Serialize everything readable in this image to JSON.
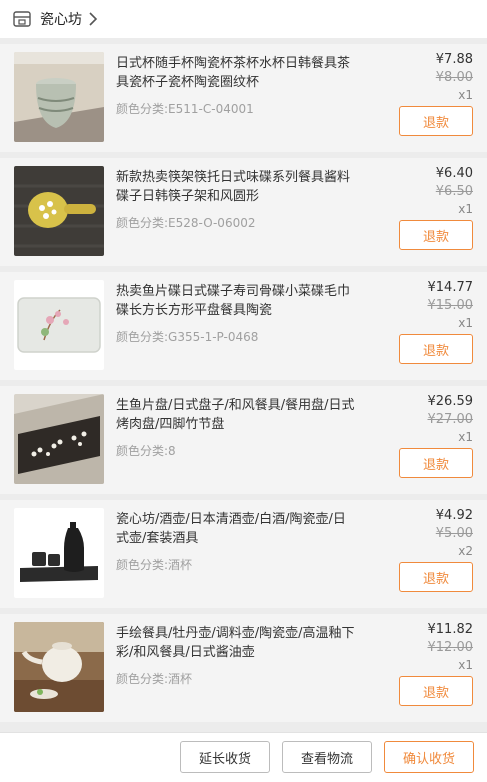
{
  "shop": {
    "name": "瓷心坊",
    "icon": "store-icon",
    "chevron": "chevron-right-icon"
  },
  "items": [
    {
      "title": "日式杯随手杯陶瓷杯茶杯水杯日韩餐具茶具瓷杯子瓷杯陶瓷圈纹杯",
      "sku": "颜色分类:E511-C-04001",
      "price": "¥7.88",
      "original_price": "¥8.00",
      "qty": "x1",
      "refund_label": "退款"
    },
    {
      "title": "新款热卖筷架筷托日式味碟系列餐具酱料碟子日韩筷子架和风圆形",
      "sku": "颜色分类:E528-O-06002",
      "price": "¥6.40",
      "original_price": "¥6.50",
      "qty": "x1",
      "refund_label": "退款"
    },
    {
      "title": "热卖鱼片碟日式碟子寿司骨碟小菜碟毛巾碟长方长方形平盘餐具陶瓷",
      "sku": "颜色分类:G355-1-P-0468",
      "price": "¥14.77",
      "original_price": "¥15.00",
      "qty": "x1",
      "refund_label": "退款"
    },
    {
      "title": "生鱼片盘/日式盘子/和风餐具/餐用盘/日式烤肉盘/四脚竹节盘",
      "sku": "颜色分类:8",
      "price": "¥26.59",
      "original_price": "¥27.00",
      "qty": "x1",
      "refund_label": "退款"
    },
    {
      "title": "瓷心坊/酒壶/日本清酒壶/白酒/陶瓷壶/日式壶/套装酒具",
      "sku": "颜色分类:酒杯",
      "price": "¥4.92",
      "original_price": "¥5.00",
      "qty": "x2",
      "refund_label": "退款"
    },
    {
      "title": "手绘餐具/牡丹壶/调料壶/陶瓷壶/高温釉下彩/和风餐具/日式酱油壶",
      "sku": "颜色分类:酒杯",
      "price": "¥11.82",
      "original_price": "¥12.00",
      "qty": "x1",
      "refund_label": "退款"
    }
  ],
  "footer": {
    "extend_label": "延长收货",
    "logistics_label": "查看物流",
    "confirm_label": "确认收货"
  },
  "colors": {
    "accent": "#f08a3c"
  }
}
